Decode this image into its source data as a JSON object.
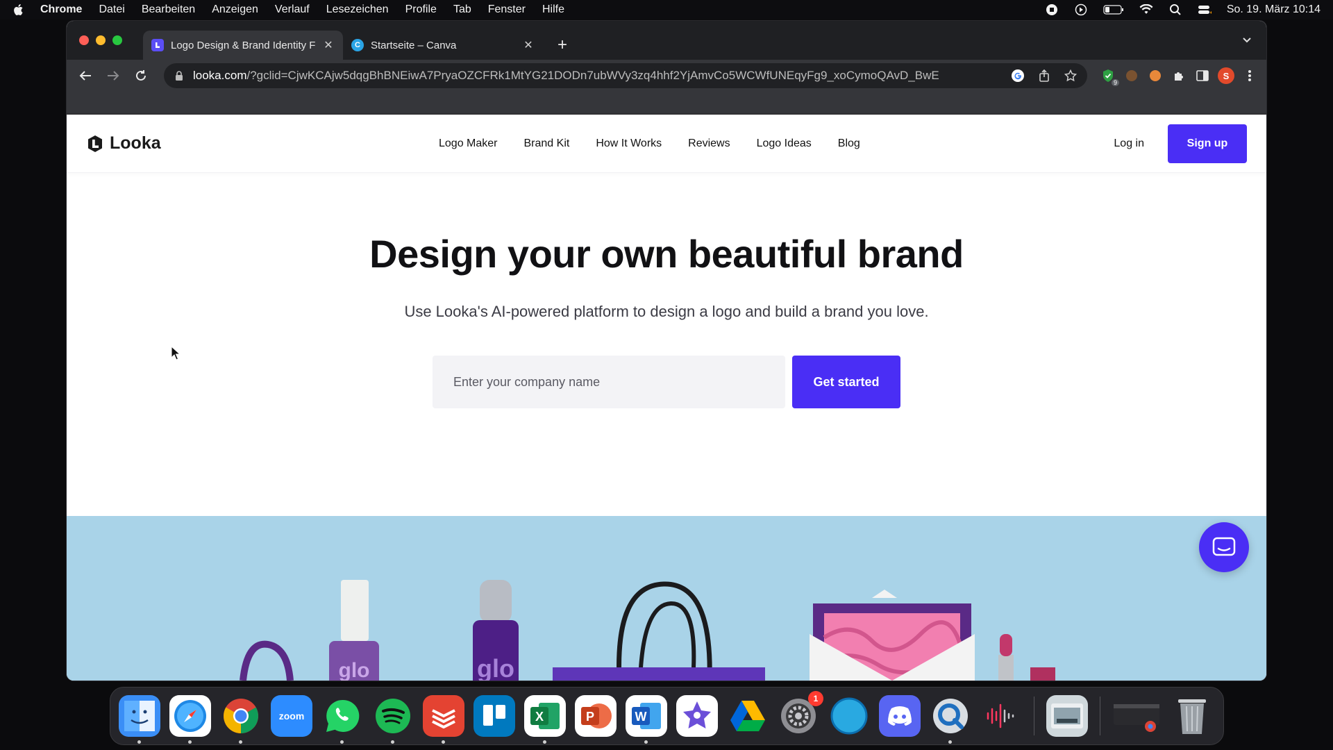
{
  "menubar": {
    "app": "Chrome",
    "items": [
      "Datei",
      "Bearbeiten",
      "Anzeigen",
      "Verlauf",
      "Lesezeichen",
      "Profile",
      "Tab",
      "Fenster",
      "Hilfe"
    ],
    "clock": "So. 19. März  10:14"
  },
  "browser": {
    "tabs": [
      {
        "title": "Logo Design & Brand Identity F",
        "icon": "looka-favicon"
      },
      {
        "title": "Startseite – Canva",
        "icon": "canva-favicon"
      }
    ],
    "url_host": "looka.com",
    "url_path": "/?gclid=CjwKCAjw5dqgBhBNEiwA7PryaOZCFRk1MtYG21DODn7ubWVy3zq4hhf2YjAmvCo5WCWfUNEqyFg9_xoCymoQAvD_BwE",
    "profile_initial": "S",
    "extension_badge": "9"
  },
  "site": {
    "brand": "Looka",
    "nav": [
      "Logo Maker",
      "Brand Kit",
      "How It Works",
      "Reviews",
      "Logo Ideas",
      "Blog"
    ],
    "login": "Log in",
    "signup": "Sign up",
    "hero_title": "Design your own beautiful brand",
    "hero_subtitle": "Use Looka's AI-powered platform to design a logo and build a brand you love.",
    "input_placeholder": "Enter your company name",
    "cta": "Get started",
    "product_label": "glo",
    "accent_color": "#4a2ef5"
  },
  "dock": {
    "apps": [
      {
        "name": "finder",
        "label": "",
        "color": "#3a8ef6",
        "running": true
      },
      {
        "name": "safari",
        "label": "",
        "color": "#1e88e5",
        "running": true
      },
      {
        "name": "chrome",
        "label": "",
        "color": "#ffffff",
        "running": true
      },
      {
        "name": "zoom",
        "label": "zoom",
        "color": "#2d8cff",
        "running": false
      },
      {
        "name": "whatsapp",
        "label": "",
        "color": "#25d366",
        "running": true
      },
      {
        "name": "spotify",
        "label": "",
        "color": "#1db954",
        "running": true
      },
      {
        "name": "todoist",
        "label": "",
        "color": "#e44332",
        "running": true
      },
      {
        "name": "trello",
        "label": "",
        "color": "#0079bf",
        "running": false
      },
      {
        "name": "excel",
        "label": "X",
        "color": "#1d6f42",
        "running": true
      },
      {
        "name": "powerpoint",
        "label": "P",
        "color": "#d04423",
        "running": false
      },
      {
        "name": "word",
        "label": "W",
        "color": "#2b579a",
        "running": true
      },
      {
        "name": "imovie",
        "label": "★",
        "color": "#6b4fd8",
        "running": false
      },
      {
        "name": "google-drive",
        "label": "",
        "color": "#ffffff",
        "running": false
      },
      {
        "name": "system-settings",
        "label": "⚙",
        "color": "#8e8e93",
        "running": false,
        "badge": "1"
      },
      {
        "name": "siri",
        "label": "",
        "color": "#29a9e1",
        "running": false
      },
      {
        "name": "discord",
        "label": "",
        "color": "#5865f2",
        "running": false
      },
      {
        "name": "quicktime",
        "label": "",
        "color": "#2a2a2e",
        "running": true
      },
      {
        "name": "voice-memos",
        "label": "",
        "color": "#1c1c1e",
        "running": false
      },
      {
        "name": "preview",
        "label": "",
        "color": "#cfd8dc",
        "running": false
      },
      {
        "name": "chrome-window",
        "label": "",
        "color": "#2a2a2e",
        "running": false
      },
      {
        "name": "trash",
        "label": "",
        "color": "#9aa0a6",
        "running": false
      }
    ]
  }
}
